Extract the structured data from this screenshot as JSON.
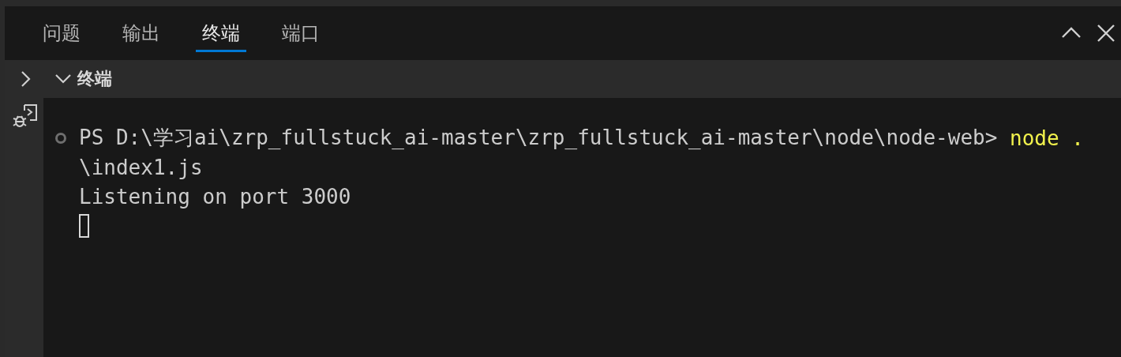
{
  "panel_tabs": [
    {
      "label": "问题",
      "selected": false
    },
    {
      "label": "输出",
      "selected": false
    },
    {
      "label": "终端",
      "selected": true
    },
    {
      "label": "端口",
      "selected": false
    }
  ],
  "section": {
    "title": "终端",
    "expanded": true
  },
  "terminal": {
    "lines": [
      {
        "kind": "prompt",
        "prompt": "PS D:\\学习ai\\zrp_fullstuck_ai-master\\zrp_fullstuck_ai-master\\node\\node-web> ",
        "command": "node ."
      },
      {
        "kind": "output",
        "text": "\\index1.js"
      },
      {
        "kind": "output",
        "text": "Listening on port 3000"
      },
      {
        "kind": "cursor"
      }
    ]
  }
}
